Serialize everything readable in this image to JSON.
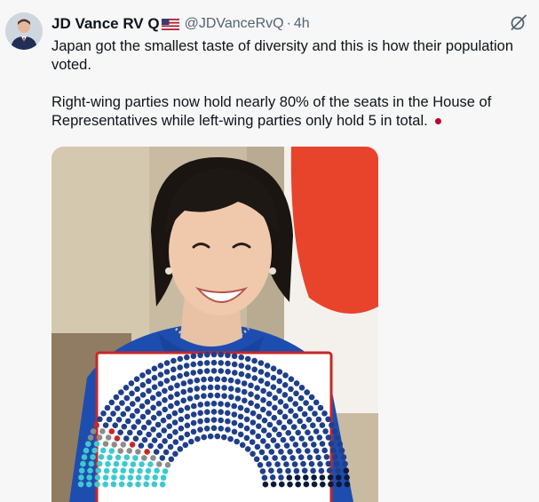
{
  "author": {
    "display_name": "JD Vance RV Q",
    "handle": "@JDVanceRvQ",
    "separator": "·",
    "time": "4h",
    "avatar_icon": "avatar-portrait-icon",
    "flag_icon": "us-flag-icon"
  },
  "tweet": {
    "line1": "Japan got the smallest taste of diversity and this is how their population voted.",
    "line2": "Right-wing parties now hold nearly 80% of the seats in the House of Representatives while left-wing parties only hold 5 in total.",
    "emoji_icon": "japan-flag-emoji-icon"
  },
  "actions": {
    "grok_icon": "grok-icon"
  },
  "media": {
    "subject": "portrait-photo",
    "overlay": "seat-chart",
    "flag_colors": {
      "red": "#bc002d",
      "white": "#ffffff"
    }
  },
  "chart_data": {
    "type": "parliament",
    "series": [
      {
        "color": "#3ec9cf",
        "seats": 55
      },
      {
        "color": "#8c8c8c",
        "seats": 15
      },
      {
        "color": "#c62828",
        "seats": 5
      },
      {
        "color": "#1f3f8a",
        "seats": 370
      },
      {
        "color": "#0a1a3a",
        "seats": 20
      }
    ]
  }
}
